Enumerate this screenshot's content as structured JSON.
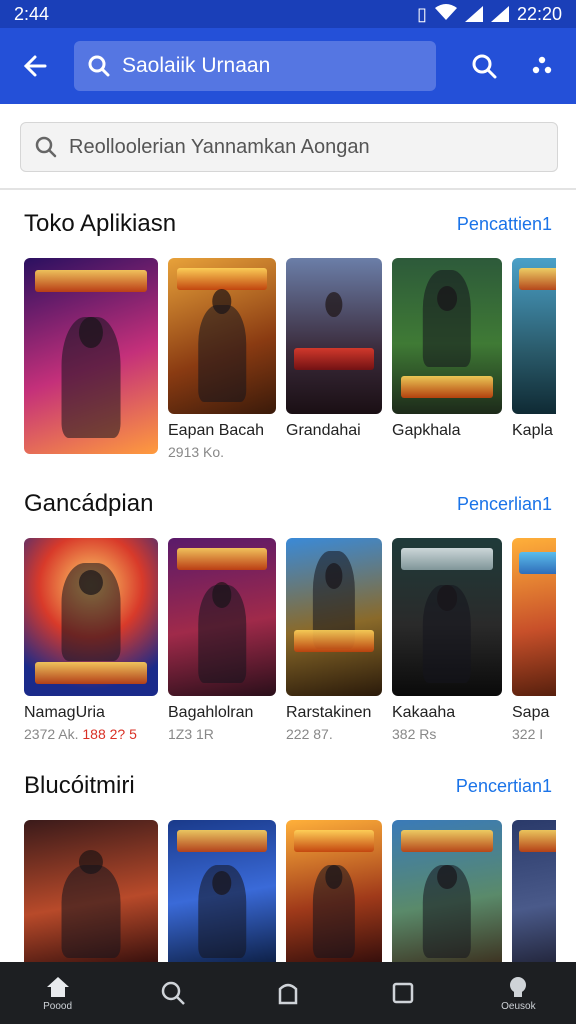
{
  "status": {
    "time_left": "2:44",
    "time_right": "22:20"
  },
  "appbar": {
    "search_text": "Saolaiik Urnaan"
  },
  "search": {
    "placeholder": "Reolloolerian Yannamkan Aongan"
  },
  "sections": [
    {
      "title": "Toko Aplikiasn",
      "link": "Pencattien1",
      "items": [
        {
          "title": "",
          "sub": ""
        },
        {
          "title": "Eapan Bacah",
          "sub": "2913 Ko."
        },
        {
          "title": "Grandahai",
          "sub": ""
        },
        {
          "title": "Gapkhala",
          "sub": ""
        },
        {
          "title": "Kapla",
          "sub": ""
        }
      ]
    },
    {
      "title": "Gancádpian",
      "link": "Pencerlian1",
      "items": [
        {
          "title": "NamagUria",
          "sub": "2372 Ak.",
          "sub_red": "188 2? 5"
        },
        {
          "title": "Bagahlolran",
          "sub": "1Z3 1R"
        },
        {
          "title": "Rarstakinen",
          "sub": "222 87."
        },
        {
          "title": "Kakaaha",
          "sub": "382 Rs"
        },
        {
          "title": "Sapa",
          "sub": "322 I"
        }
      ]
    },
    {
      "title": "Blucóitmiri",
      "link": "Pencertian1",
      "items": [
        {},
        {},
        {},
        {},
        {}
      ]
    }
  ],
  "nav": {
    "home_label": "Poood",
    "account_label": "Oeusok"
  },
  "colors": {
    "appbar": "#2450d8",
    "status": "#1a3fb8",
    "link": "#1a73e8",
    "nav": "#1d1f22"
  }
}
